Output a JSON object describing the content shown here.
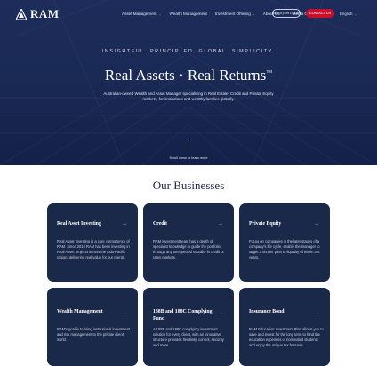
{
  "header": {
    "logo_text": "RAM",
    "menu": [
      {
        "label": "Asset Management",
        "has_dropdown": true
      },
      {
        "label": "Wealth Management",
        "has_dropdown": false
      },
      {
        "label": "Investment Offering",
        "has_dropdown": true
      },
      {
        "label": "About Us",
        "has_dropdown": true
      },
      {
        "label": "Media Centre",
        "has_dropdown": false
      }
    ],
    "investor_button": "INVESTOR LOGIN",
    "contact_button": "CONTACT US",
    "language": "English",
    "chevron": "⌄"
  },
  "hero": {
    "tagline": "INSIGHTFUL. PRINCIPLED. GLOBAL. SIMPLICITY.",
    "headline_main": "Real Assets · Real Returns",
    "headline_tm": "™",
    "subtitle": "Australian-owned Wealth and Asset Manager specialising in Real Estate, Credit and Private Equity markets, for institutions and wealthy families globally.",
    "scroll_text": "Scroll down to learn more",
    "background_color": "#1d2c5a"
  },
  "businesses": {
    "title": "Our Businesses",
    "arrow": "→",
    "cards": [
      {
        "title": "Real Asset Investing",
        "body": "Real Asset Investing is a core competence of RAM. Since 2018 RAM has been investing in Real Asset projects across the Asia-Pacific region, delivering real value for our clients."
      },
      {
        "title": "Credit",
        "body": "RAM investment team has a depth of specialist knowledge to guide the portfolio through any unexpected volatility in credit or rates markets."
      },
      {
        "title": "Private Equity",
        "body": "Focus on companies in the later stages of a company's life cycle, enable the manager to target a shorter path to liquidity of within 3-5 years."
      },
      {
        "title": "Wealth Management",
        "body": "RAM's goal is to bring institutional investment and risk management to the private client world."
      },
      {
        "title": "188B and 188C Complying Fund",
        "body": "A 188B and 188C complying investment solution for every client, with an innovative structure provides flexibility, control, security and more."
      },
      {
        "title": "Insurance Bond",
        "body": "RAM Education Investment Plan allows you to save and invest for the long term to fund the education expenses of nominated students and enjoy the unique tax features."
      }
    ]
  },
  "colors": {
    "navy": "#1a2849",
    "accent_red": "#c8102e",
    "heading": "#1a2444"
  }
}
